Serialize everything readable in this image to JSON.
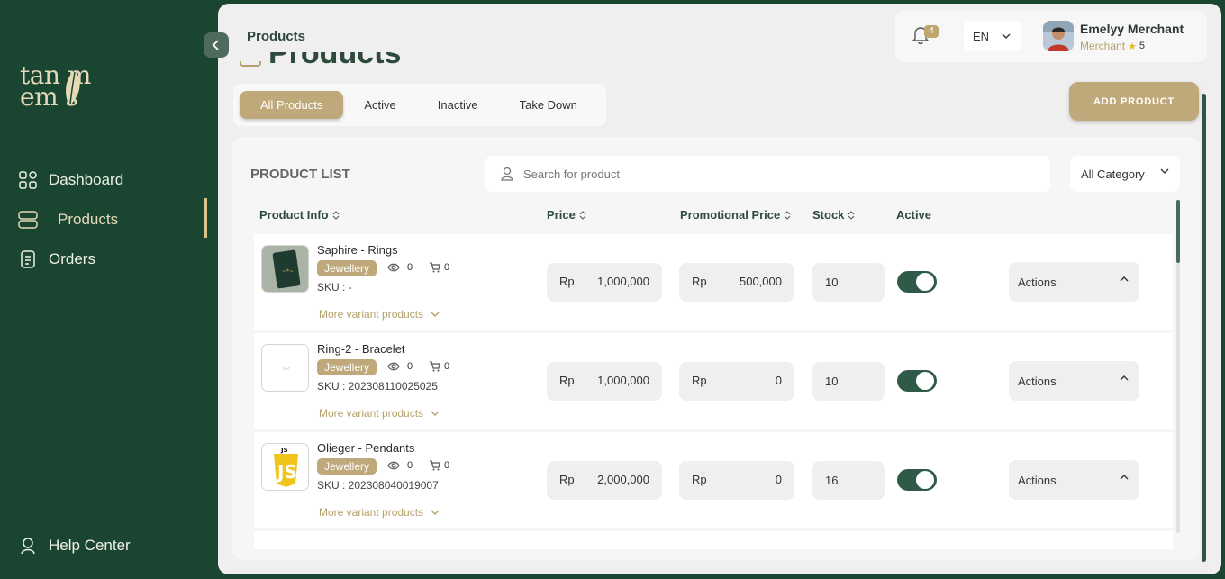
{
  "sidebar": {
    "logo_line1": "tan m",
    "logo_line2": "em s",
    "items": [
      {
        "label": "Dashboard"
      },
      {
        "label": "Products"
      },
      {
        "label": "Orders"
      }
    ],
    "help": "Help Center"
  },
  "header": {
    "page_title": "Products",
    "ghost_title": "Products",
    "notifications": "4",
    "language": "EN",
    "user_name": "Emelyy Merchant",
    "user_role": "Merchant",
    "rating": "5"
  },
  "tabs": [
    "All Products",
    "Active",
    "Inactive",
    "Take Down"
  ],
  "add_button": "ADD PRODUCT",
  "list": {
    "title": "PRODUCT LIST",
    "search_placeholder": "Search for product",
    "category": "All Category",
    "columns": [
      "Product Info",
      "Price",
      "Promotional Price",
      "Stock",
      "Active"
    ],
    "currency": "Rp",
    "more_label": "More variant products",
    "actions_label": "Actions",
    "rows": [
      {
        "name": "Saphire - Rings",
        "tag": "Jewellery",
        "views": "0",
        "cart": "0",
        "sku": "SKU : -",
        "price": "1,000,000",
        "promo": "500,000",
        "stock": "10",
        "active": true
      },
      {
        "name": "Ring-2 - Bracelet",
        "tag": "Jewellery",
        "views": "0",
        "cart": "0",
        "sku": "SKU : 202308110025025",
        "price": "1,000,000",
        "promo": "0",
        "stock": "10",
        "active": true
      },
      {
        "name": "Olieger - Pendants",
        "tag": "Jewellery",
        "views": "0",
        "cart": "0",
        "sku": "SKU : 202308040019007",
        "price": "2,000,000",
        "promo": "0",
        "stock": "16",
        "active": true
      }
    ]
  },
  "colors": {
    "sidebar_bg": "#1a4631",
    "accent_gold": "#bfa87a",
    "toggle_green": "#2f5a48"
  }
}
